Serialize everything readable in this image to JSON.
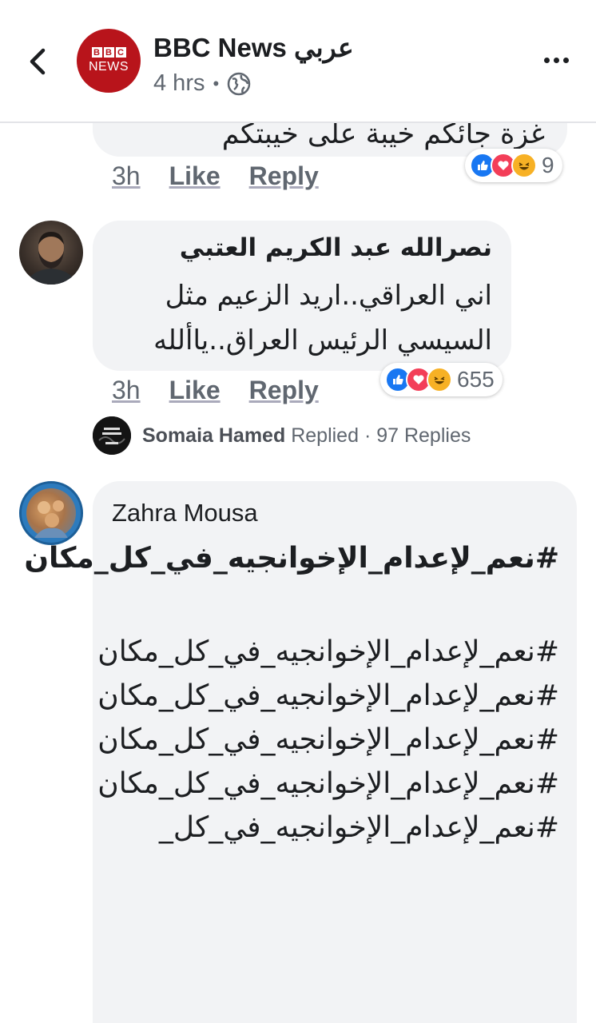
{
  "header": {
    "title": "BBC News عربي",
    "time": "4 hrs",
    "avatar_top": "BBC",
    "avatar_bottom": "NEWS"
  },
  "comments": [
    {
      "text_partial": "غزة جائكم خيبة على خيبتكم",
      "time": "3h",
      "like_label": "Like",
      "reply_label": "Reply",
      "reaction_count": "9"
    },
    {
      "author": "نصرالله عبد الكريم العتبي",
      "text": "اني العراقي..اريد الزعيم مثل السيسي الرئيس العراق..ياألله",
      "time": "3h",
      "like_label": "Like",
      "reply_label": "Reply",
      "reaction_count": "655",
      "replies_summary": {
        "replier": "Somaia Hamed",
        "action": "Replied",
        "count_label": "97 Replies"
      }
    },
    {
      "author": "Zahra Mousa",
      "bold_text": "#نعم_لإعدام_الإخوانجيه_في_كل_مكان",
      "text": "#نعم_لإعدام_الإخوانجيه_في_كل_مكان #نعم_لإعدام_الإخوانجيه_في_كل_مكان #نعم_لإعدام_الإخوانجيه_في_كل_مكان #نعم_لإعدام_الإخوانجيه_في_كل_مكان #نعم_لإعدام_الإخوانجيه_في_كل_"
    }
  ],
  "colors": {
    "like": "#1877f2",
    "love": "#f33e58",
    "haha": "#f7b125",
    "bbc_red": "#b8141b"
  }
}
